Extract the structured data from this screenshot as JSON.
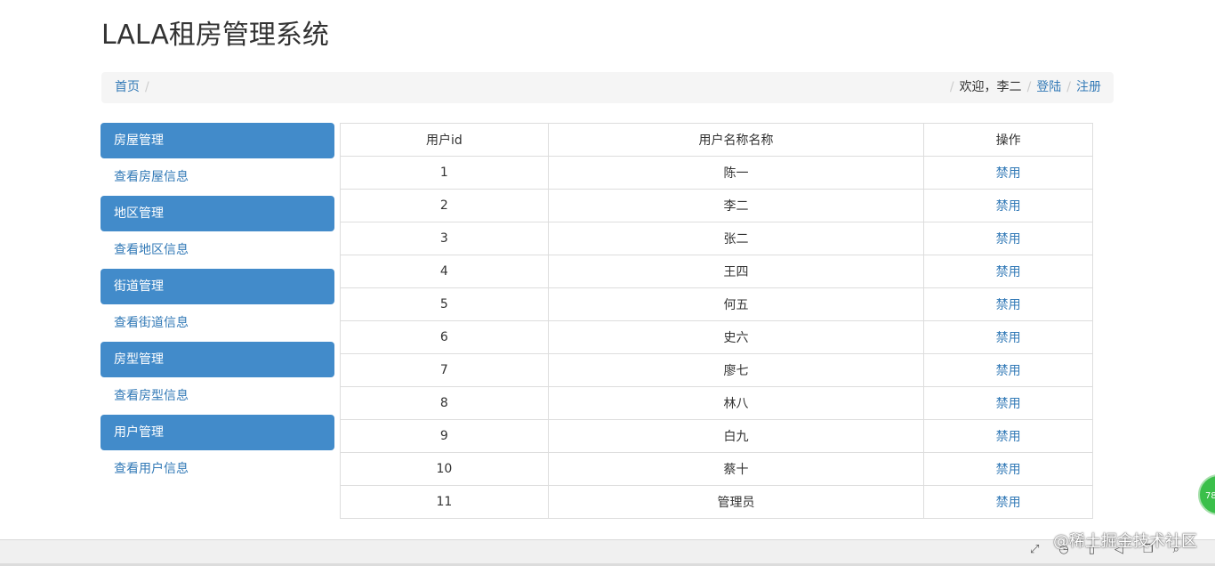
{
  "app_title": "LALA租房管理系统",
  "breadcrumb": {
    "home": "首页",
    "separator": "/",
    "welcome": "欢迎，李二",
    "login": "登陆",
    "register": "注册"
  },
  "sidebar": {
    "groups": [
      {
        "title": "房屋管理",
        "link": "查看房屋信息"
      },
      {
        "title": "地区管理",
        "link": "查看地区信息"
      },
      {
        "title": "街道管理",
        "link": "查看街道信息"
      },
      {
        "title": "房型管理",
        "link": "查看房型信息"
      },
      {
        "title": "用户管理",
        "link": "查看用户信息"
      }
    ]
  },
  "table": {
    "headers": [
      "用户id",
      "用户名称名称",
      "操作"
    ],
    "rows": [
      {
        "id": "1",
        "name": "陈一",
        "action": "禁用"
      },
      {
        "id": "2",
        "name": "李二",
        "action": "禁用"
      },
      {
        "id": "3",
        "name": "张二",
        "action": "禁用"
      },
      {
        "id": "4",
        "name": "王四",
        "action": "禁用"
      },
      {
        "id": "5",
        "name": "何五",
        "action": "禁用"
      },
      {
        "id": "6",
        "name": "史六",
        "action": "禁用"
      },
      {
        "id": "7",
        "name": "廖七",
        "action": "禁用"
      },
      {
        "id": "8",
        "name": "林八",
        "action": "禁用"
      },
      {
        "id": "9",
        "name": "白九",
        "action": "禁用"
      },
      {
        "id": "10",
        "name": "蔡十",
        "action": "禁用"
      },
      {
        "id": "11",
        "name": "管理员",
        "action": "禁用"
      }
    ]
  },
  "floating_badge": "78",
  "watermark": "@稀土掘金技术社区",
  "colors": {
    "accent": "#428bca",
    "link": "#337ab7",
    "breadcrumb_bg": "#f5f5f5",
    "table_border": "#dddddd"
  }
}
